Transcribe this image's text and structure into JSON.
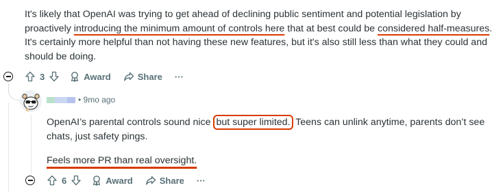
{
  "comment1": {
    "seg1": "It's likely that OpenAI was trying to get ahead of declining public sentiment and potential legislation by proactively ",
    "seg2_underlined": "introducing the minimum amount of controls here",
    "seg3": " that at best could be ",
    "seg4_underlined": "considered half-measures",
    "seg5": ". It's certainly more helpful than not having these new features, but it's also still less than what they could and should be doing.",
    "votes": "3",
    "award_label": "Award",
    "share_label": "Share",
    "more_label": "···"
  },
  "reply": {
    "time": "• 9mo ago",
    "seg1": "OpenAI’s parental controls sound nice ",
    "seg2_boxed": "but super limited.",
    "seg3": " Teens can unlink anytime, parents don’t see chats, just safety pings.",
    "line2_underlined": "Feels more PR than real oversight.",
    "votes": "6",
    "award_label": "Award",
    "share_label": "Share",
    "more_label": "···"
  },
  "colors": {
    "annotation_red": "#d93a00",
    "meta_gray": "#576f76",
    "text": "#2a3236"
  }
}
